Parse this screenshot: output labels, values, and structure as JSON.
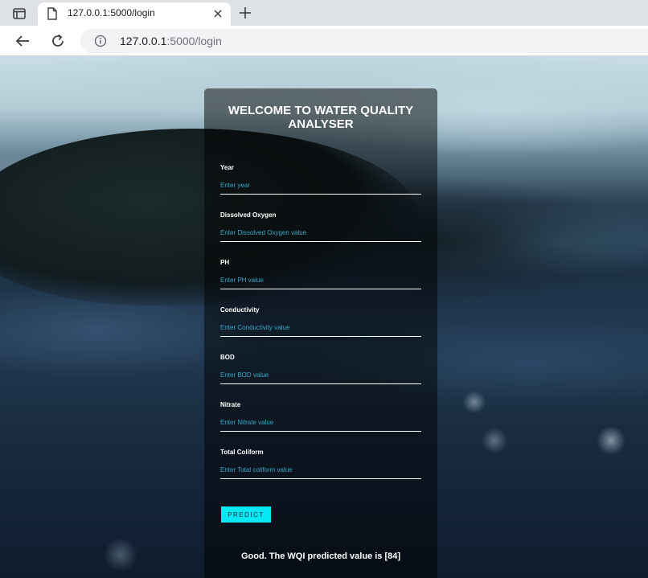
{
  "browser": {
    "tab_title": "127.0.0.1:5000/login",
    "url_host": "127.0.0.1",
    "url_rest": ":5000/login"
  },
  "page": {
    "heading": "WELCOME TO WATER QUALITY ANALYSER",
    "fields": [
      {
        "label": "Year",
        "placeholder": "Enter year"
      },
      {
        "label": "Dissolved Oxygen",
        "placeholder": "Enter Dissolved Oxygen value"
      },
      {
        "label": "PH",
        "placeholder": "Enter PH value"
      },
      {
        "label": "Conductivity",
        "placeholder": "Enter Conductivity value"
      },
      {
        "label": "BOD",
        "placeholder": "Enter BOD value"
      },
      {
        "label": "Nitrate",
        "placeholder": "Enter Nitrate value"
      },
      {
        "label": "Total Coliform",
        "placeholder": "Enter Total coliform value"
      }
    ],
    "predict_label": "PREDICT",
    "result_text": "Good. The WQI predicted value is [84]"
  },
  "colors": {
    "accent": "#03e9f4",
    "placeholder": "#35a8c6"
  }
}
